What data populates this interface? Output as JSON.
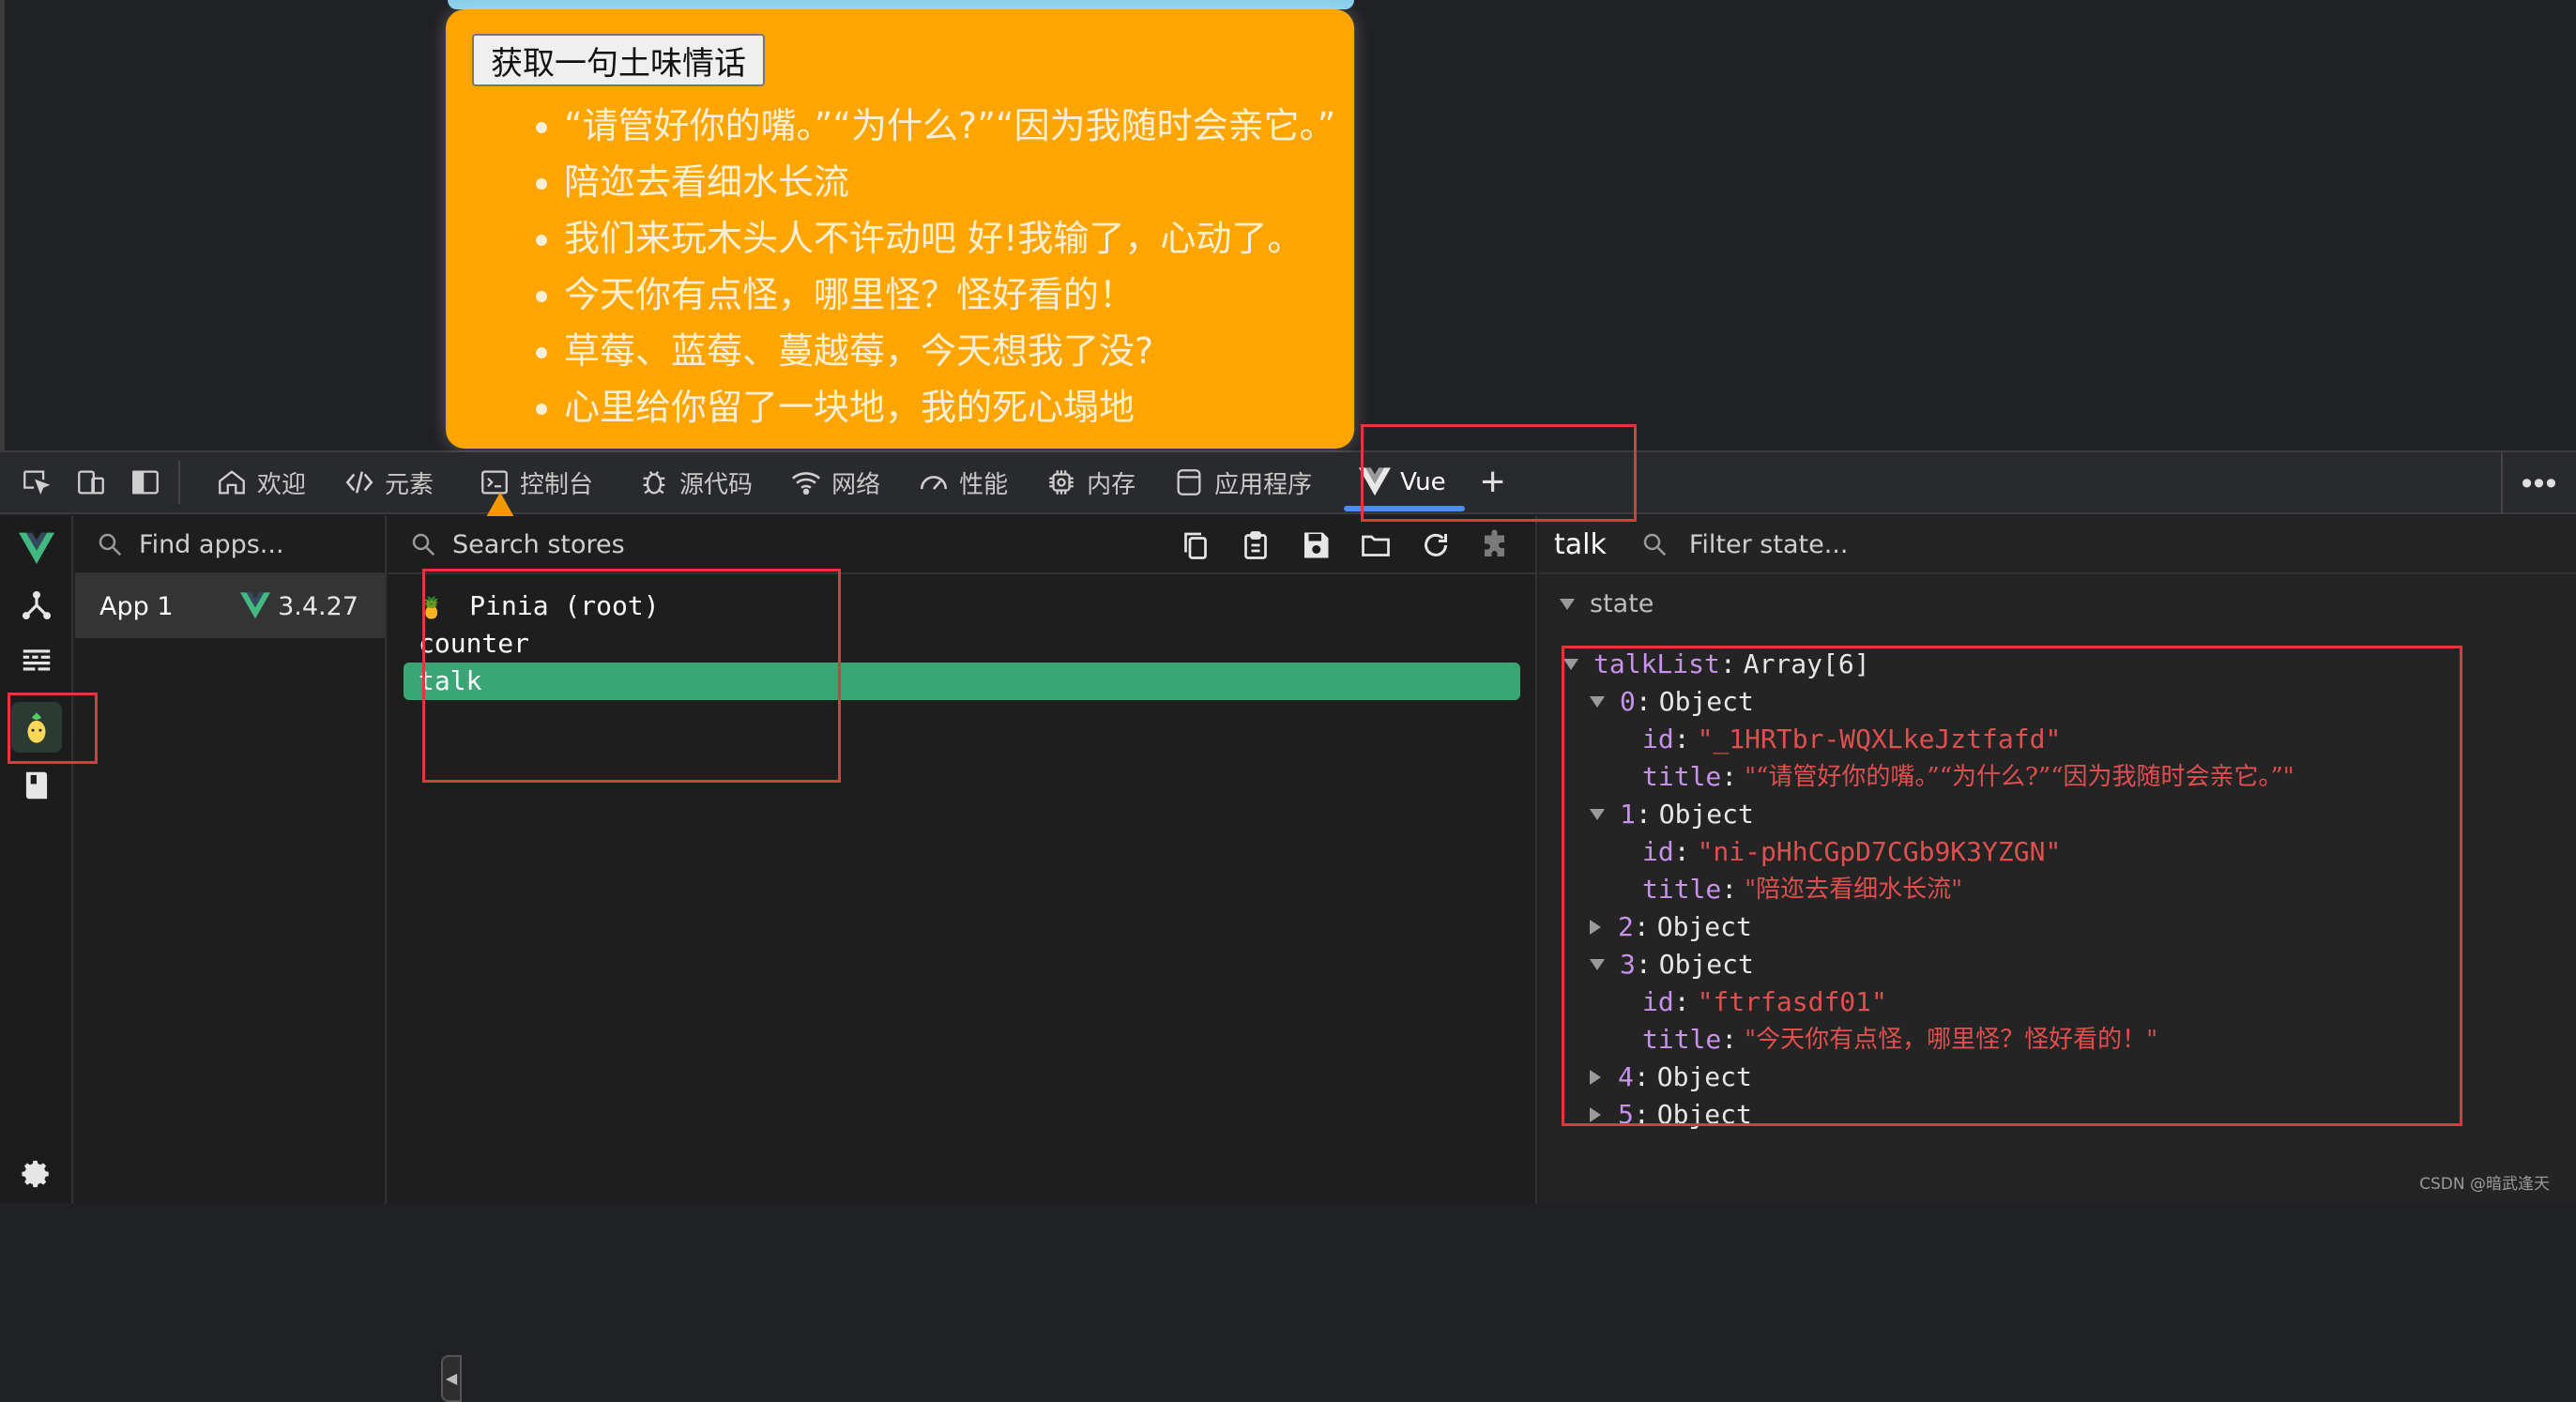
{
  "page": {
    "button_label": "获取一句土味情话",
    "talks": [
      "“请管好你的嘴。”“为什么?”“因为我随时会亲它。”",
      "陪迩去看细水长流",
      "我们来玩木头人不许动吧 好!我输了，心动了。",
      "今天你有点怪，哪里怪？怪好看的！",
      "草莓、蓝莓、蔓越莓，今天想我了没?",
      "心里给你留了一块地，我的死心塌地"
    ]
  },
  "devtools_tabs": [
    {
      "label": "欢迎",
      "icon": "home-icon"
    },
    {
      "label": "元素",
      "icon": "code-icon"
    },
    {
      "label": "控制台",
      "icon": "console-icon"
    },
    {
      "label": "源代码",
      "icon": "bug-icon"
    },
    {
      "label": "网络",
      "icon": "wifi-icon"
    },
    {
      "label": "性能",
      "icon": "gauge-icon"
    },
    {
      "label": "内存",
      "icon": "chip-icon"
    },
    {
      "label": "应用程序",
      "icon": "app-window-icon"
    },
    {
      "label": "Vue",
      "icon": "vue-logo-icon",
      "active": true
    }
  ],
  "apps": {
    "search_placeholder": "Find apps...",
    "items": [
      {
        "name": "App 1",
        "version": "3.4.27"
      }
    ]
  },
  "stores": {
    "search_placeholder": "Search stores",
    "root_label": "Pinia (root)",
    "items": [
      "counter",
      "talk"
    ],
    "selected": "talk"
  },
  "state": {
    "store_name": "talk",
    "filter_placeholder": "Filter state...",
    "section": "state",
    "root_key": "talkList",
    "root_type": "Array[6]",
    "entries": [
      {
        "index": "0",
        "type": "Object",
        "expanded": true,
        "id": "\"_1HRTbr-WQXLkeJztfafd\"",
        "title": "\"“请管好你的嘴。”“为什么?”“因为我随时会亲它。”\""
      },
      {
        "index": "1",
        "type": "Object",
        "expanded": true,
        "id": "\"ni-pHhCGpD7CGb9K3YZGN\"",
        "title": "\"陪迩去看细水长流\""
      },
      {
        "index": "2",
        "type": "Object",
        "expanded": false
      },
      {
        "index": "3",
        "type": "Object",
        "expanded": true,
        "id": "\"ftrfasdf01\"",
        "title": "\"今天你有点怪，哪里怪？怪好看的！\""
      },
      {
        "index": "4",
        "type": "Object",
        "expanded": false
      },
      {
        "index": "5",
        "type": "Object",
        "expanded": false
      }
    ],
    "id_key": "id",
    "title_key": "title"
  },
  "watermark": "CSDN @暗武逢天",
  "colors": {
    "vue_green": "#42b883",
    "selected_row": "#3aa675",
    "annotation_red": "#e0383d",
    "card_orange": "#ffa500"
  }
}
